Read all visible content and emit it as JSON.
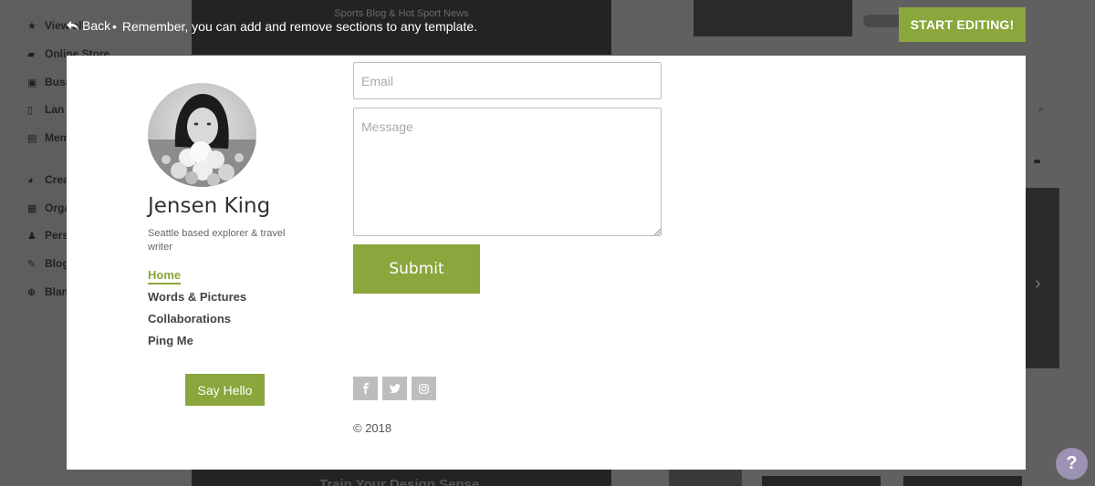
{
  "background": {
    "sidebar": [
      {
        "icon": "star-icon",
        "glyph": "★",
        "label": "View all"
      },
      {
        "icon": "cart-icon",
        "glyph": "🛒",
        "label": "Online Store"
      },
      {
        "icon": "briefcase-icon",
        "glyph": "▣",
        "label": "Busi"
      },
      {
        "icon": "document-icon",
        "glyph": "▯",
        "label": "Lan"
      },
      {
        "icon": "members-icon",
        "glyph": "▤",
        "label": "Mem"
      },
      {
        "icon": "palette-icon",
        "glyph": "◕",
        "label": "Crea"
      },
      {
        "icon": "building-icon",
        "glyph": "▦",
        "label": "Orga"
      },
      {
        "icon": "person-icon",
        "glyph": "♟",
        "label": "Pers"
      },
      {
        "icon": "pen-icon",
        "glyph": "✎",
        "label": "Blog"
      },
      {
        "icon": "plus-circle-icon",
        "glyph": "⊕",
        "label": "Blan"
      }
    ],
    "center_header": "Sports Blog & Hot Sport News",
    "center_footer": "Train Your Design Sense"
  },
  "toolbar": {
    "back_label": "Back",
    "separator": "•",
    "notice": "Remember, you can add and remove sections to any template.",
    "start_label": "START EDITING!"
  },
  "profile": {
    "name": "Jensen King",
    "tagline": "Seattle based explorer & travel writer"
  },
  "nav": {
    "items": [
      {
        "label": "Home",
        "active": true
      },
      {
        "label": "Words & Pictures",
        "active": false
      },
      {
        "label": "Collaborations",
        "active": false
      },
      {
        "label": "Ping Me",
        "active": false
      }
    ]
  },
  "say_hello_label": "Say Hello",
  "form": {
    "email_placeholder": "Email",
    "message_placeholder": "Message",
    "submit_label": "Submit"
  },
  "social": [
    "facebook-icon",
    "twitter-icon",
    "instagram-icon"
  ],
  "copyright": "© 2018",
  "help_label": "?",
  "colors": {
    "accent": "#8aa63c",
    "help": "#9c92b4",
    "overlay": "#606060"
  }
}
